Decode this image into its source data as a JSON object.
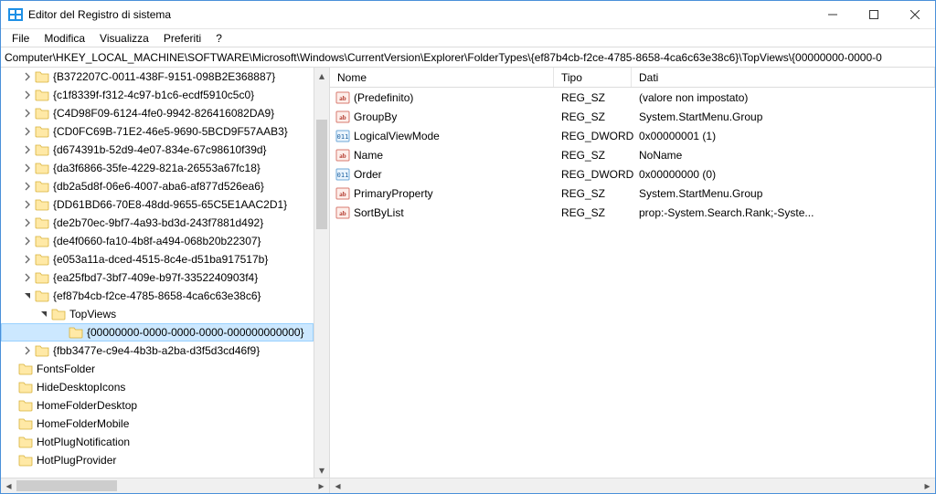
{
  "window": {
    "title": "Editor del Registro di sistema"
  },
  "menu": {
    "file": "File",
    "edit": "Modifica",
    "view": "Visualizza",
    "favorites": "Preferiti",
    "help": "?"
  },
  "address": {
    "path": "Computer\\HKEY_LOCAL_MACHINE\\SOFTWARE\\Microsoft\\Windows\\CurrentVersion\\Explorer\\FolderTypes\\{ef87b4cb-f2ce-4785-8658-4ca6c63e38c6}\\TopViews\\{00000000-0000-0"
  },
  "tree": {
    "items": [
      {
        "label": "{B372207C-0011-438F-9151-098B2E368887}",
        "depth": 1,
        "expandable": true,
        "expanded": false
      },
      {
        "label": "{c1f8339f-f312-4c97-b1c6-ecdf5910c5c0}",
        "depth": 1,
        "expandable": true,
        "expanded": false
      },
      {
        "label": "{C4D98F09-6124-4fe0-9942-826416082DA9}",
        "depth": 1,
        "expandable": true,
        "expanded": false
      },
      {
        "label": "{CD0FC69B-71E2-46e5-9690-5BCD9F57AAB3}",
        "depth": 1,
        "expandable": true,
        "expanded": false
      },
      {
        "label": "{d674391b-52d9-4e07-834e-67c98610f39d}",
        "depth": 1,
        "expandable": true,
        "expanded": false
      },
      {
        "label": "{da3f6866-35fe-4229-821a-26553a67fc18}",
        "depth": 1,
        "expandable": true,
        "expanded": false
      },
      {
        "label": "{db2a5d8f-06e6-4007-aba6-af877d526ea6}",
        "depth": 1,
        "expandable": true,
        "expanded": false
      },
      {
        "label": "{DD61BD66-70E8-48dd-9655-65C5E1AAC2D1}",
        "depth": 1,
        "expandable": true,
        "expanded": false
      },
      {
        "label": "{de2b70ec-9bf7-4a93-bd3d-243f7881d492}",
        "depth": 1,
        "expandable": true,
        "expanded": false
      },
      {
        "label": "{de4f0660-fa10-4b8f-a494-068b20b22307}",
        "depth": 1,
        "expandable": true,
        "expanded": false
      },
      {
        "label": "{e053a11a-dced-4515-8c4e-d51ba917517b}",
        "depth": 1,
        "expandable": true,
        "expanded": false
      },
      {
        "label": "{ea25fbd7-3bf7-409e-b97f-3352240903f4}",
        "depth": 1,
        "expandable": true,
        "expanded": false
      },
      {
        "label": "{ef87b4cb-f2ce-4785-8658-4ca6c63e38c6}",
        "depth": 1,
        "expandable": true,
        "expanded": true
      },
      {
        "label": "TopViews",
        "depth": 2,
        "expandable": true,
        "expanded": true
      },
      {
        "label": "{00000000-0000-0000-0000-000000000000}",
        "depth": 3,
        "expandable": false,
        "expanded": false,
        "selected": true
      },
      {
        "label": "{fbb3477e-c9e4-4b3b-a2ba-d3f5d3cd46f9}",
        "depth": 1,
        "expandable": true,
        "expanded": false
      },
      {
        "label": "FontsFolder",
        "depth": 0,
        "expandable": false,
        "expanded": false
      },
      {
        "label": "HideDesktopIcons",
        "depth": 0,
        "expandable": false,
        "expanded": false
      },
      {
        "label": "HomeFolderDesktop",
        "depth": 0,
        "expandable": false,
        "expanded": false
      },
      {
        "label": "HomeFolderMobile",
        "depth": 0,
        "expandable": false,
        "expanded": false
      },
      {
        "label": "HotPlugNotification",
        "depth": 0,
        "expandable": false,
        "expanded": false
      },
      {
        "label": "HotPlugProvider",
        "depth": 0,
        "expandable": false,
        "expanded": false
      }
    ]
  },
  "values": {
    "columns": {
      "name": "Nome",
      "type": "Tipo",
      "data": "Dati"
    },
    "rows": [
      {
        "icon": "string",
        "name": "(Predefinito)",
        "type": "REG_SZ",
        "data": "(valore non impostato)"
      },
      {
        "icon": "string",
        "name": "GroupBy",
        "type": "REG_SZ",
        "data": "System.StartMenu.Group"
      },
      {
        "icon": "binary",
        "name": "LogicalViewMode",
        "type": "REG_DWORD",
        "data": "0x00000001 (1)"
      },
      {
        "icon": "string",
        "name": "Name",
        "type": "REG_SZ",
        "data": "NoName"
      },
      {
        "icon": "binary",
        "name": "Order",
        "type": "REG_DWORD",
        "data": "0x00000000 (0)"
      },
      {
        "icon": "string",
        "name": "PrimaryProperty",
        "type": "REG_SZ",
        "data": "System.StartMenu.Group"
      },
      {
        "icon": "string",
        "name": "SortByList",
        "type": "REG_SZ",
        "data": "prop:-System.Search.Rank;-Syste..."
      }
    ]
  }
}
